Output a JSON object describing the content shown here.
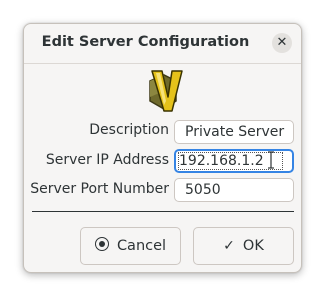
{
  "dialog": {
    "title": "Edit Server Configuration",
    "close_glyph": "✕",
    "logo_icon": "server-app-logo-icon"
  },
  "form": {
    "description": {
      "label": "Description",
      "value": "Private Server"
    },
    "server_ip": {
      "label": "Server IP Address",
      "value": "192.168.1.2"
    },
    "server_port": {
      "label": "Server Port Number",
      "value": "5050"
    }
  },
  "buttons": {
    "cancel": {
      "label": "Cancel",
      "icon": "cancel-icon"
    },
    "ok": {
      "label": "OK",
      "icon": "checkmark-icon",
      "glyph": "✓"
    }
  },
  "colors": {
    "focus": "#3584e4",
    "logo_yellow": "#e5c21a",
    "logo_olive": "#7a7a2a"
  }
}
